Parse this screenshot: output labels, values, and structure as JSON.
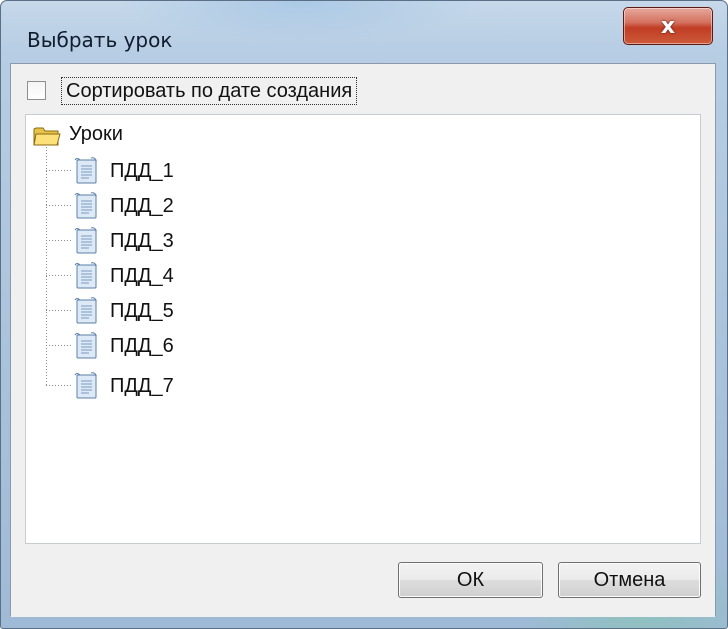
{
  "window": {
    "title": "Выбрать урок",
    "close_label": "x"
  },
  "sort": {
    "label": "Сортировать по дате создания",
    "checked": false
  },
  "tree": {
    "root": {
      "label": "Уроки",
      "icon": "folder-icon"
    },
    "items": [
      {
        "label": "ПДД_1",
        "icon": "document-icon"
      },
      {
        "label": "ПДД_2",
        "icon": "document-icon"
      },
      {
        "label": "ПДД_3",
        "icon": "document-icon"
      },
      {
        "label": "ПДД_4",
        "icon": "document-icon"
      },
      {
        "label": "ПДД_5",
        "icon": "document-icon"
      },
      {
        "label": "ПДД_6",
        "icon": "document-icon"
      },
      {
        "label": "ПДД_7",
        "icon": "document-icon"
      }
    ]
  },
  "buttons": {
    "ok": "ОК",
    "cancel": "Отмена"
  },
  "colors": {
    "frame": "#a9c2db",
    "close_button": "#c13d24",
    "client_background": "#f0f0f0",
    "tree_background": "#ffffff"
  }
}
